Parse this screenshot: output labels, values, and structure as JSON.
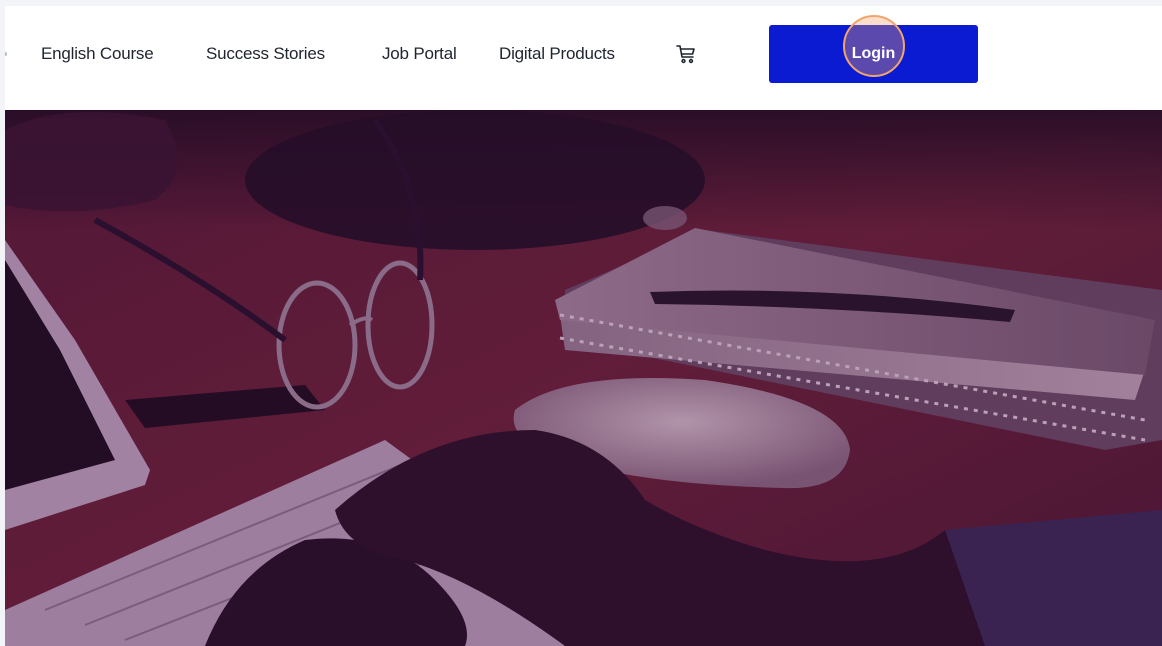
{
  "nav": {
    "links": [
      {
        "label": "English Course"
      },
      {
        "label": "Success Stories"
      },
      {
        "label": "Job Portal"
      },
      {
        "label": "Digital Products"
      }
    ],
    "cart_icon": "shopping-cart-icon",
    "login_label": "Login"
  },
  "colors": {
    "login_button": "#0a1bd1",
    "click_highlight": "#f2a56b",
    "hero_tint": "#4a1640"
  },
  "hero": {
    "image": "desk-with-laptop-glasses-notebook-hands-typing"
  }
}
